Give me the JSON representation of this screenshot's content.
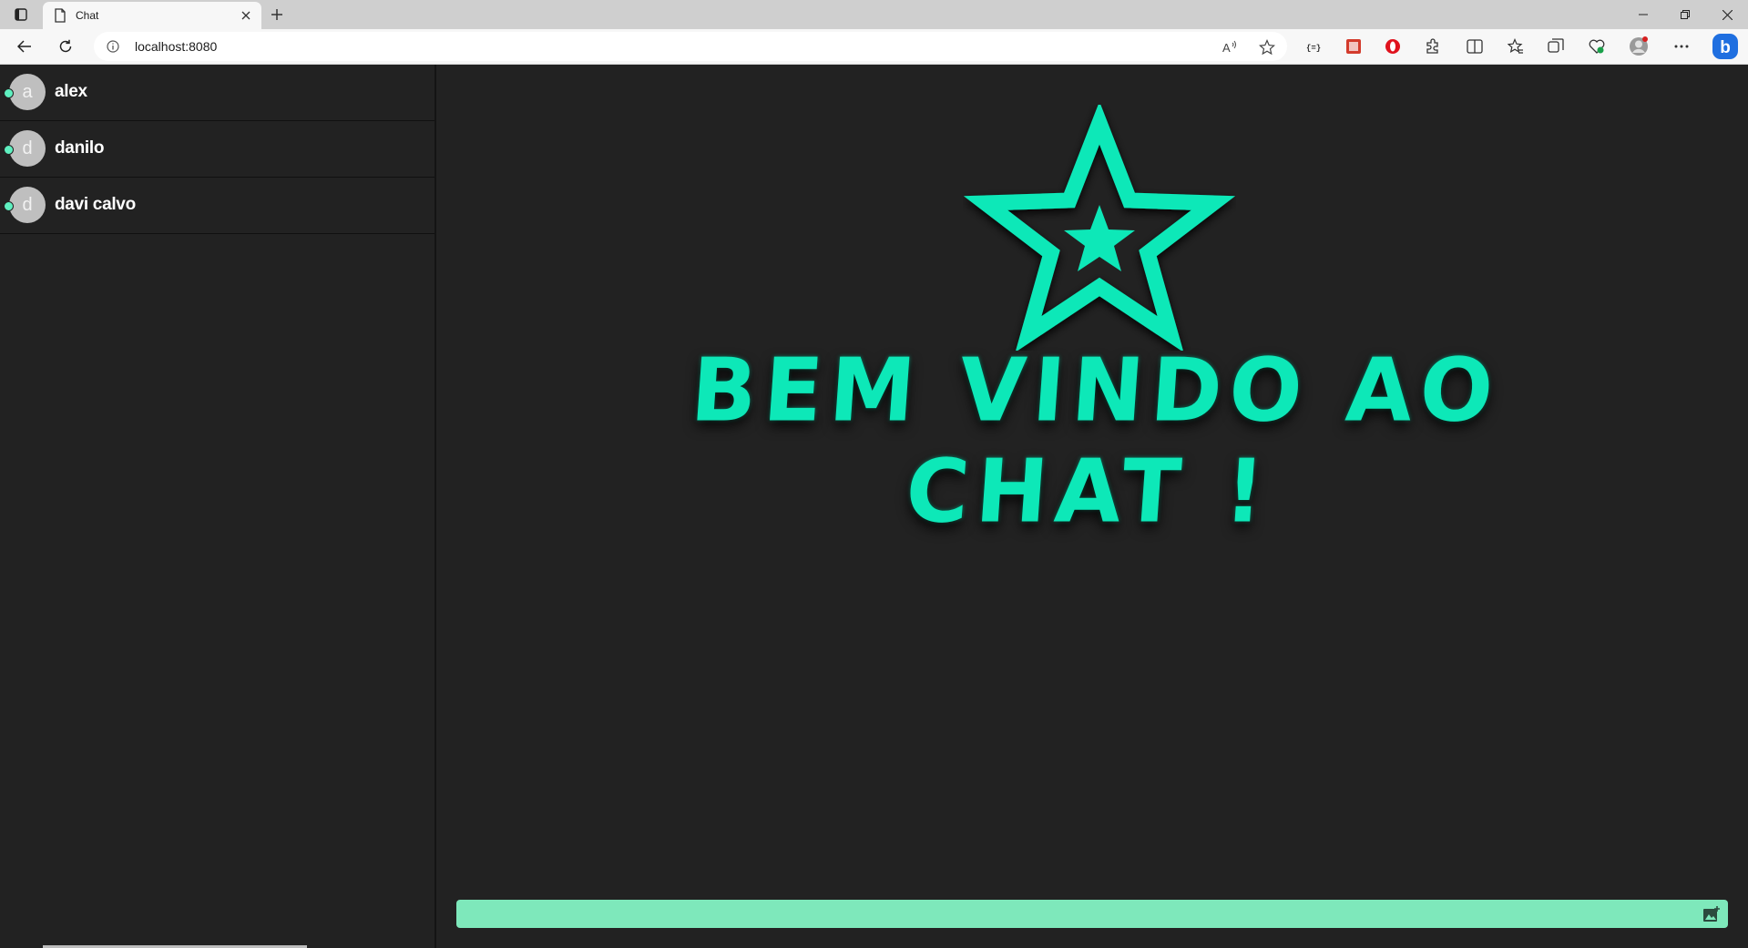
{
  "browser": {
    "tab_title": "Chat",
    "url": "localhost:8080"
  },
  "contacts": [
    {
      "initial": "a",
      "name": "alex"
    },
    {
      "initial": "d",
      "name": "danilo"
    },
    {
      "initial": "d",
      "name": "davi calvo"
    }
  ],
  "main": {
    "welcome_text": "BEM VINDO AO CHAT !",
    "message_placeholder": ""
  },
  "colors": {
    "accent": "#0de8b8",
    "composer": "#7ee8bb",
    "background": "#222222",
    "online": "#5ff0c0"
  },
  "icons": [
    "sidebar-toggle-icon",
    "page-icon",
    "close-icon",
    "plus-icon",
    "back-icon",
    "refresh-icon",
    "info-icon",
    "read-aloud-icon",
    "favorite-star-icon",
    "extension-icon",
    "pdf-icon",
    "opera-icon",
    "puzzle-icon",
    "split-screen-icon",
    "favorites-icon",
    "collections-icon",
    "performance-icon",
    "profile-icon",
    "more-icon",
    "bing-icon",
    "star-logo-icon",
    "image-upload-icon"
  ]
}
